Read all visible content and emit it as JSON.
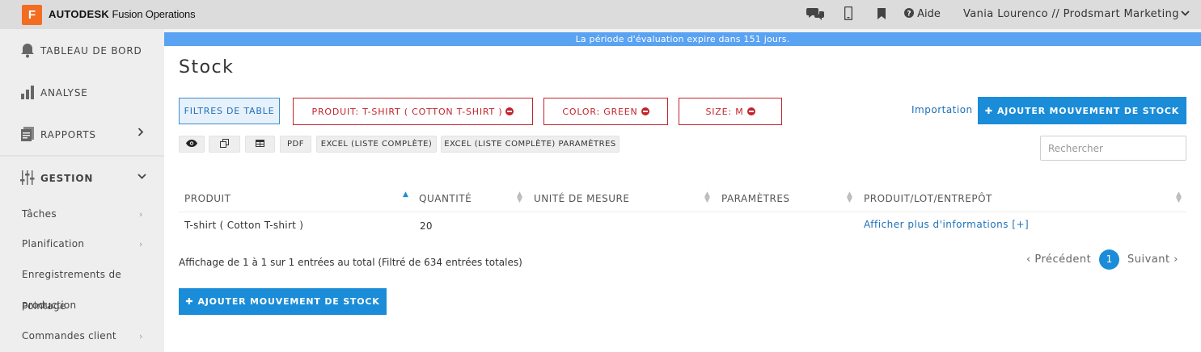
{
  "topbar": {
    "logo_letter": "F",
    "brand": "AUTODESK",
    "product": "Fusion Operations",
    "help_label": "Aide",
    "user_label": "Vania Lourenco // Prodsmart Marketing"
  },
  "sidebar": {
    "main_items": [
      {
        "label": "TABLEAU DE BORD",
        "icon": "bell-icon"
      },
      {
        "label": "ANALYSE",
        "icon": "bar-chart-icon"
      },
      {
        "label": "RAPPORTS",
        "icon": "report-icon"
      },
      {
        "label": "GESTION",
        "icon": "sliders-icon"
      }
    ],
    "sub_items": [
      {
        "label": "Tâches"
      },
      {
        "label": "Planification"
      },
      {
        "label": "Enregistrements de"
      },
      {
        "label": "production"
      },
      {
        "label": "Pointage"
      },
      {
        "label": "Commandes client"
      }
    ]
  },
  "trial_banner": "La période d'évaluation expire dans 151 jours.",
  "page": {
    "title": "Stock",
    "filters_button": "FILTRES DE TABLE",
    "filter_chips": [
      {
        "label": "PRODUIT: T-SHIRT ( COTTON T-SHIRT )"
      },
      {
        "label": "COLOR: GREEN"
      },
      {
        "label": "SIZE: M"
      }
    ],
    "import_link": "Importation",
    "add_button": "AJOUTER MOUVEMENT DE STOCK",
    "add_button_bottom": "AJOUTER MOUVEMENT DE STOCK",
    "tools": {
      "pdf": "PDF",
      "excel_full": "EXCEL (LISTE COMPLÈTE)",
      "excel_full_params": "EXCEL (LISTE COMPLÈTE) PARAMÈTRES"
    },
    "search_placeholder": "Rechercher"
  },
  "table": {
    "columns": [
      "PRODUIT",
      "QUANTITÉ",
      "UNITÉ DE MESURE",
      "PARAMÈTRES",
      "PRODUIT/LOT/ENTREPÔT"
    ],
    "rows": [
      {
        "produit": "T-shirt ( Cotton T-shirt )",
        "quantite": "20",
        "unite": "",
        "parametres": "",
        "lien": "Afficher plus d'informations [+]"
      }
    ]
  },
  "footer": {
    "info": "Affichage de 1 à 1 sur 1 entrées au total (Filtré de 634 entrées totales)",
    "prev": "Précédent",
    "next": "Suivant",
    "current_page": "1"
  },
  "colors": {
    "accent_blue": "#1a8cd8",
    "banner_blue": "#5aa2f2",
    "filter_red": "#c3232b",
    "brand_orange": "#f26d21"
  }
}
